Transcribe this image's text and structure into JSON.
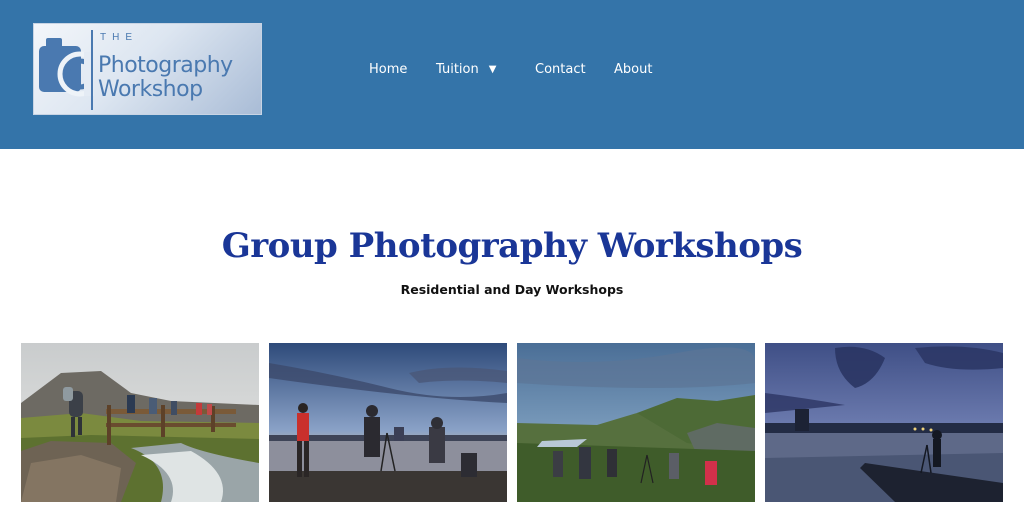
{
  "logo": {
    "the": "THE",
    "line1": "Photography",
    "line2": "Workshop"
  },
  "nav": {
    "home": "Home",
    "tuition": "Tuition",
    "tuition_caret": "▼",
    "contact": "Contact",
    "about": "About"
  },
  "main": {
    "title": "Group Photography Workshops",
    "subtitle": "Residential and Day Workshops"
  },
  "colors": {
    "header_bg": "#3474a9",
    "title": "#1a3697",
    "logo_text": "#4a79b0"
  }
}
